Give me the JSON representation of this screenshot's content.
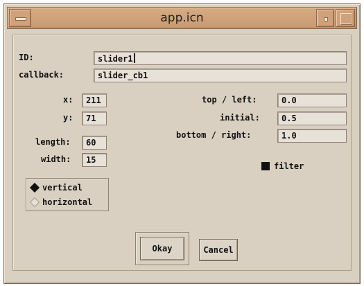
{
  "window": {
    "title": "app.icn"
  },
  "form": {
    "id_label": "ID:",
    "id_value": "slider1",
    "callback_label": "callback:",
    "callback_value": "slider_cb1",
    "x_label": "x:",
    "x_value": "211",
    "y_label": "y:",
    "y_value": "71",
    "length_label": "length:",
    "length_value": "60",
    "width_label": "width:",
    "width_value": "15",
    "top_left_label": "top / left:",
    "top_left_value": "0.0",
    "initial_label": "initial:",
    "initial_value": "0.5",
    "bottom_right_label": "bottom / right:",
    "bottom_right_value": "1.0",
    "filter_label": "filter",
    "filter_checked": true,
    "orientation": {
      "selected": "vertical",
      "options": [
        "vertical",
        "horizontal"
      ]
    }
  },
  "buttons": {
    "okay": "Okay",
    "cancel": "Cancel"
  },
  "icons": [
    "window-menu-icon",
    "minimize-icon",
    "maximize-icon"
  ]
}
